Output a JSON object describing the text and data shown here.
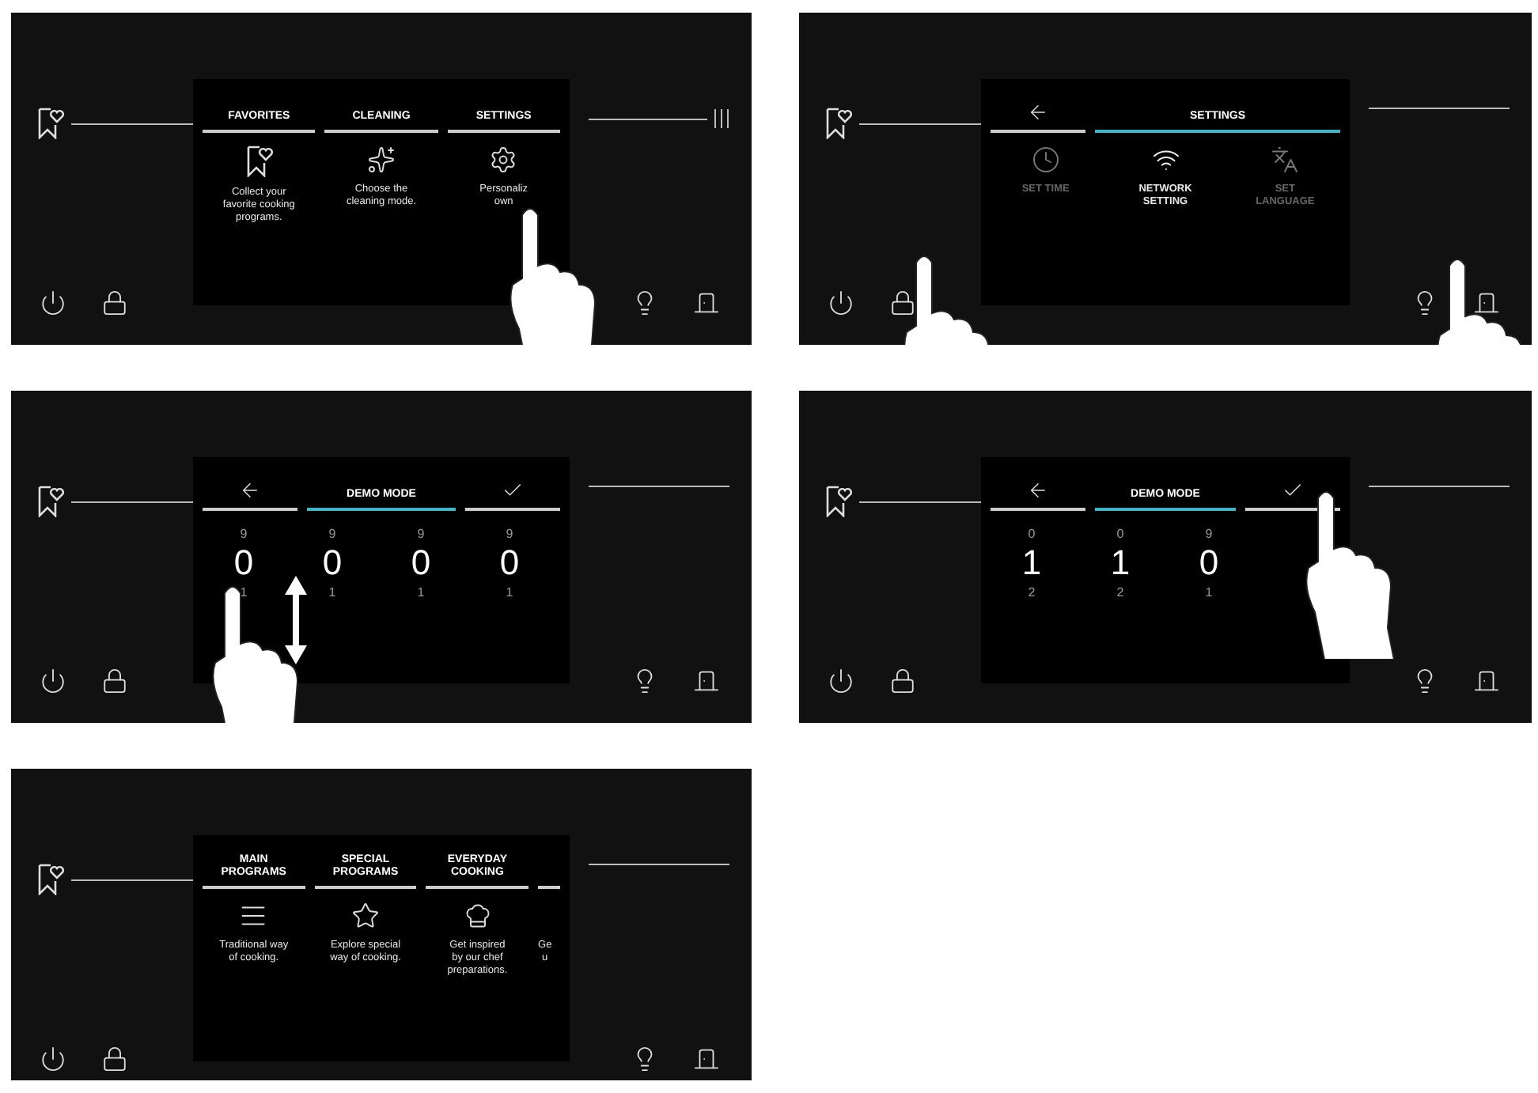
{
  "panels": [
    {
      "kind": "menu",
      "tabs": [
        {
          "label": "FAVORITES",
          "desc": "Collect your\nfavorite cooking\nprograms."
        },
        {
          "label": "CLEANING",
          "desc": "Choose the\ncleaning mode."
        },
        {
          "label": "SETTINGS",
          "desc": "Personaliz\nown"
        }
      ]
    },
    {
      "kind": "settings",
      "tabs": [
        {
          "kind": "back",
          "selected": false
        },
        {
          "kind": "title",
          "label": "SETTINGS",
          "selected": true
        }
      ],
      "items": [
        {
          "label": "SET TIME",
          "selected": false
        },
        {
          "label": "NETWORK\nSETTING",
          "selected": true
        },
        {
          "label": "SET\nLANGUAGE",
          "selected": false
        }
      ]
    },
    {
      "kind": "digits",
      "tabs": [
        {
          "kind": "back",
          "selected": false
        },
        {
          "kind": "title",
          "label": "DEMO MODE",
          "selected": true
        },
        {
          "kind": "confirm",
          "selected": false
        }
      ],
      "columns": [
        {
          "above": "9",
          "value": "0",
          "below": "1"
        },
        {
          "above": "9",
          "value": "0",
          "below": "1"
        },
        {
          "above": "9",
          "value": "0",
          "below": "1"
        },
        {
          "above": "9",
          "value": "0",
          "below": "1"
        }
      ]
    },
    {
      "kind": "digits",
      "tabs": [
        {
          "kind": "back",
          "selected": false
        },
        {
          "kind": "title",
          "label": "DEMO MODE",
          "selected": true
        },
        {
          "kind": "confirm",
          "selected": false
        }
      ],
      "columns": [
        {
          "above": "0",
          "value": "1",
          "below": "2"
        },
        {
          "above": "0",
          "value": "1",
          "below": "2"
        },
        {
          "above": "9",
          "value": "0",
          "below": "1"
        }
      ]
    },
    {
      "kind": "menu",
      "tabs": [
        {
          "label": "MAIN\nPROGRAMS",
          "desc": "Traditional way\nof cooking."
        },
        {
          "label": "SPECIAL\nPROGRAMS",
          "desc": "Explore special\nway of cooking."
        },
        {
          "label": "EVERYDAY\nCOOKING",
          "desc": "Get inspired\nby our chef\npreparations."
        },
        {
          "desc": "Ge\nu"
        }
      ]
    }
  ]
}
